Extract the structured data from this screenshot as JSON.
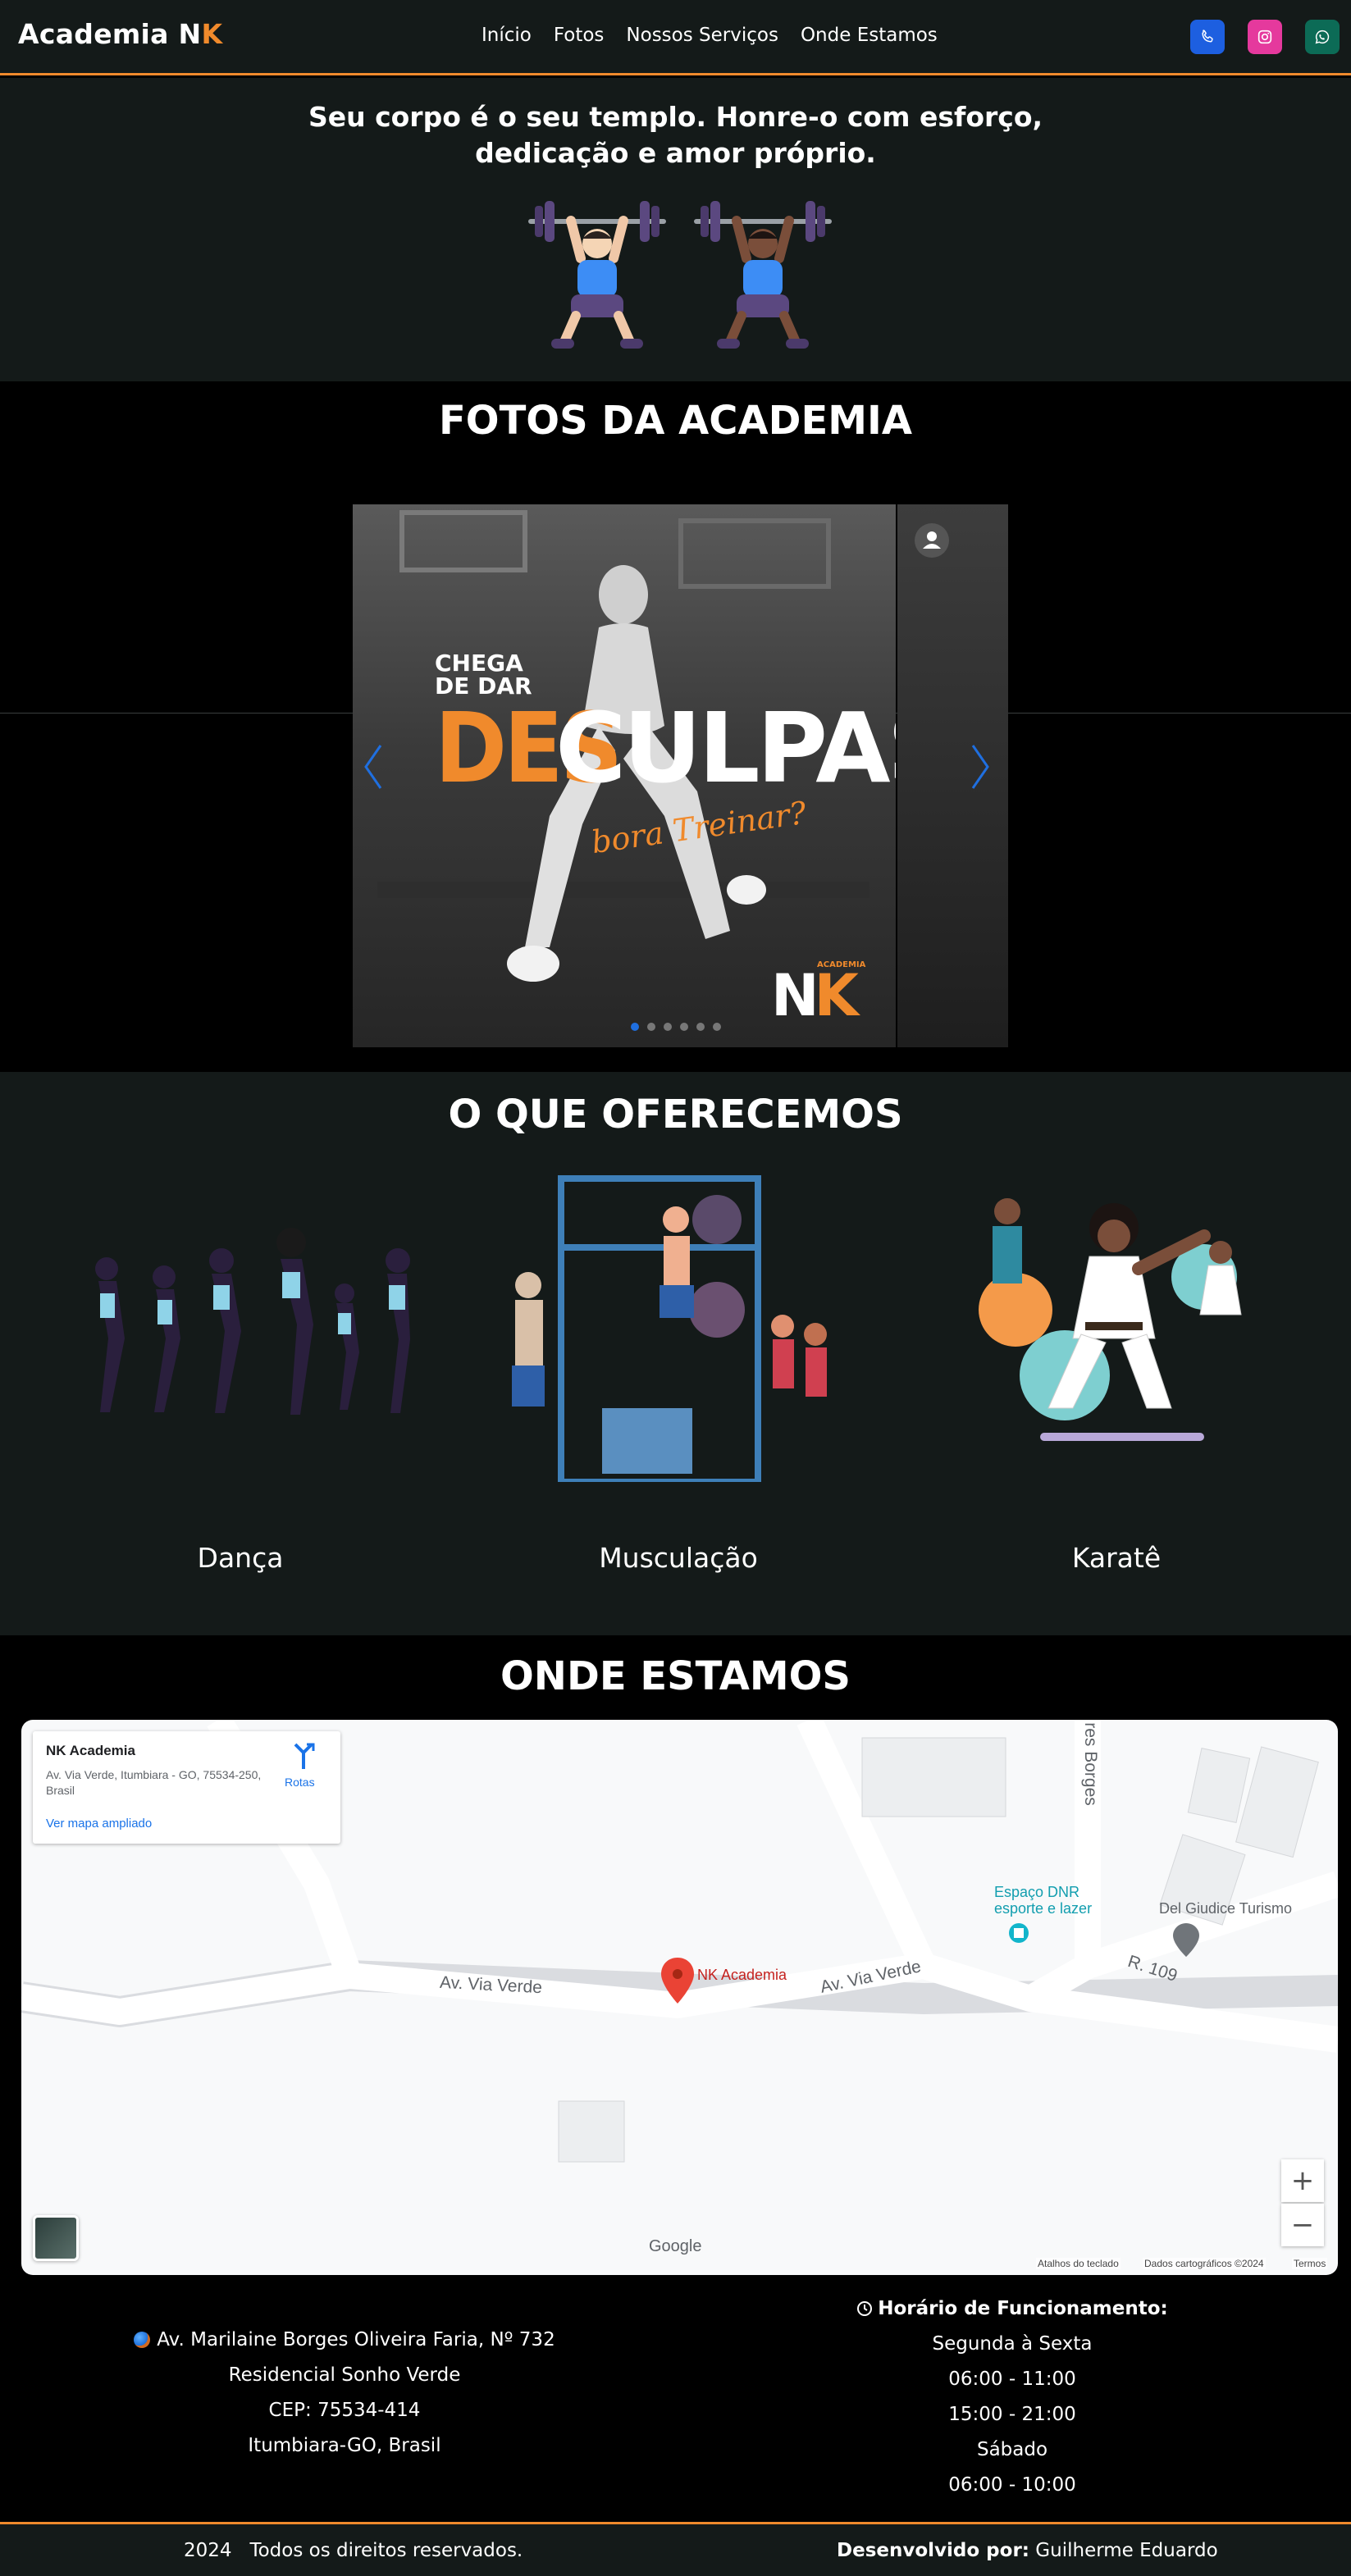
{
  "navbar": {
    "brand_main": "Academia N",
    "brand_accent": "K",
    "links": [
      "Início",
      "Fotos",
      "Nossos Serviços",
      "Onde Estamos"
    ],
    "social": [
      "phone-icon",
      "instagram-icon",
      "whatsapp-icon"
    ],
    "colors": {
      "accent": "#f08a2c",
      "phone": "#1d5fe0",
      "instagram": "#e5399d",
      "whatsapp": "#0c6b56"
    }
  },
  "hero": {
    "line1": "Seu corpo é o seu templo. Honre-o com esforço,",
    "line2": "dedicação e amor próprio."
  },
  "gallery": {
    "title": "FOTOS DA ACADEMIA",
    "slide": {
      "line_a": "CHEGA",
      "line_b": "DE DAR",
      "word_orange": "DES",
      "word_white": "CULPAS",
      "script": "bora Treinar?",
      "logo_small": "ACADEMIA",
      "logo_n": "N",
      "logo_k": "K"
    },
    "dot_count": 6,
    "active_dot": 0
  },
  "services": {
    "title": "O QUE OFERECEMOS",
    "items": [
      {
        "label": "Dança"
      },
      {
        "label": "Musculação"
      },
      {
        "label": "Karatê"
      }
    ]
  },
  "location": {
    "title": "ONDE ESTAMOS",
    "map": {
      "card_title": "NK Academia",
      "card_address": "Av. Via Verde, Itumbiara - GO, 75534-250, Brasil",
      "card_link": "Ver mapa ampliado",
      "directions": "Rotas",
      "pin_label": "NK Academia",
      "street_1": "Av. Via Verde",
      "street_2": "Av. Via Verde",
      "street_3": "R. 109",
      "street_4": "res Borges",
      "poi_1_line1": "Espaço DNR",
      "poi_1_line2": "esporte e lazer",
      "poi_2": "Del Giudice Turismo",
      "google": "Google",
      "foot_1": "Atalhos do teclado",
      "foot_2": "Dados cartográficos ©2024",
      "foot_3": "Termos",
      "zoom_in": "+",
      "zoom_out": "−"
    },
    "address": [
      "Av. Marilaine Borges Oliveira Faria, Nº 732",
      "Residencial Sonho Verde",
      "CEP: 75534-414",
      "Itumbiara-GO, Brasil"
    ],
    "hours_title": "Horário de Funcionamento:",
    "hours": [
      "Segunda à Sexta",
      "06:00 - 11:00",
      "15:00 - 21:00",
      "Sábado",
      "06:00 - 10:00"
    ]
  },
  "footer": {
    "left": "2024   Todos os direitos reservados.",
    "right_label": "Desenvolvido por:",
    "right_name": " Guilherme Eduardo"
  }
}
